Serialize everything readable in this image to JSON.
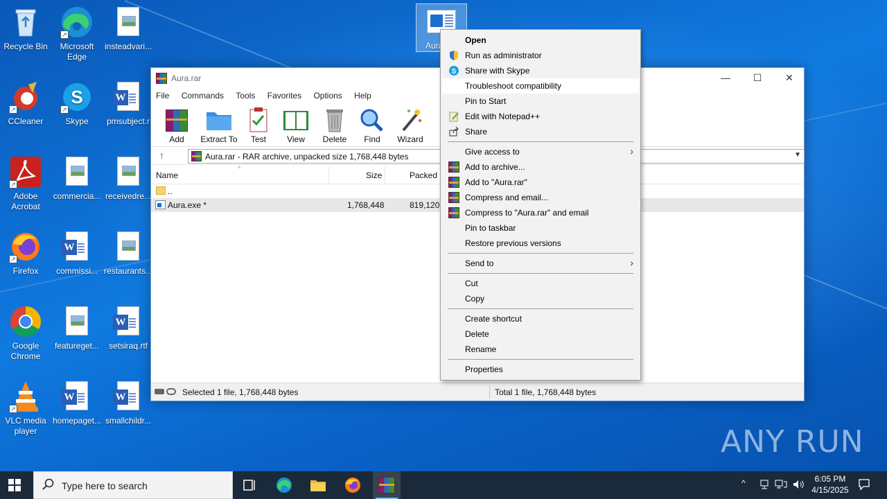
{
  "desktop": {
    "icons": [
      {
        "label": "Recycle Bin"
      },
      {
        "label": "Microsoft Edge"
      },
      {
        "label": "insteadvari..."
      },
      {
        "label": "CCleaner"
      },
      {
        "label": "Skype"
      },
      {
        "label": "pmsubject.r"
      },
      {
        "label": "Adobe Acrobat"
      },
      {
        "label": "commercia..."
      },
      {
        "label": "receivedre..."
      },
      {
        "label": "Firefox"
      },
      {
        "label": "commissi..."
      },
      {
        "label": "restaurants..."
      },
      {
        "label": "Google Chrome"
      },
      {
        "label": "featureget..."
      },
      {
        "label": "setsiraq.rtf"
      },
      {
        "label": "VLC media player"
      },
      {
        "label": "homepaget..."
      },
      {
        "label": "smallchildr..."
      }
    ],
    "selected_icon_label": "Aura"
  },
  "winrar": {
    "title": "Aura.rar",
    "menu": [
      "File",
      "Commands",
      "Tools",
      "Favorites",
      "Options",
      "Help"
    ],
    "toolbar": [
      "Add",
      "Extract To",
      "Test",
      "View",
      "Delete",
      "Find",
      "Wizard"
    ],
    "address": "Aura.rar - RAR archive, unpacked size 1,768,448 bytes",
    "columns": {
      "name": "Name",
      "size": "Size",
      "packed": "Packed"
    },
    "rows": [
      {
        "name": "..",
        "size": "",
        "packed": ""
      },
      {
        "name": "Aura.exe *",
        "size": "1,768,448",
        "packed": "819,120"
      }
    ],
    "status_left": "Selected 1 file, 1,768,448 bytes",
    "status_right": "Total 1 file, 1,768,448 bytes"
  },
  "context_menu": {
    "items": [
      {
        "label": "Open",
        "icon": "none"
      },
      {
        "label": "Run as administrator",
        "icon": "shield-icon"
      },
      {
        "label": "Share with Skype",
        "icon": "skype-icon"
      },
      {
        "label": "Troubleshoot compatibility",
        "icon": "none"
      },
      {
        "label": "Pin to Start",
        "icon": "none"
      },
      {
        "label": "Edit with Notepad++",
        "icon": "notepad-icon"
      },
      {
        "label": "Share",
        "icon": "share-icon"
      },
      {
        "label": "Give access to",
        "icon": "none"
      },
      {
        "label": "Add to archive...",
        "icon": "winrar-icon"
      },
      {
        "label": "Add to \"Aura.rar\"",
        "icon": "winrar-icon"
      },
      {
        "label": "Compress and email...",
        "icon": "winrar-icon"
      },
      {
        "label": "Compress to \"Aura.rar\" and email",
        "icon": "winrar-icon"
      },
      {
        "label": "Pin to taskbar",
        "icon": "none"
      },
      {
        "label": "Restore previous versions",
        "icon": "none"
      },
      {
        "label": "Send to",
        "icon": "none"
      },
      {
        "label": "Cut",
        "icon": "none"
      },
      {
        "label": "Copy",
        "icon": "none"
      },
      {
        "label": "Create shortcut",
        "icon": "none"
      },
      {
        "label": "Delete",
        "icon": "none"
      },
      {
        "label": "Rename",
        "icon": "none"
      },
      {
        "label": "Properties",
        "icon": "none"
      }
    ]
  },
  "taskbar": {
    "search_placeholder": "Type here to search",
    "time": "6:05 PM",
    "date": "4/15/2025"
  },
  "watermark": "ANY RUN",
  "colors": {
    "desktop_blue": "#0f7ae0",
    "taskbar": "#1b2a3a",
    "menu_bg": "#f2f2f2"
  }
}
